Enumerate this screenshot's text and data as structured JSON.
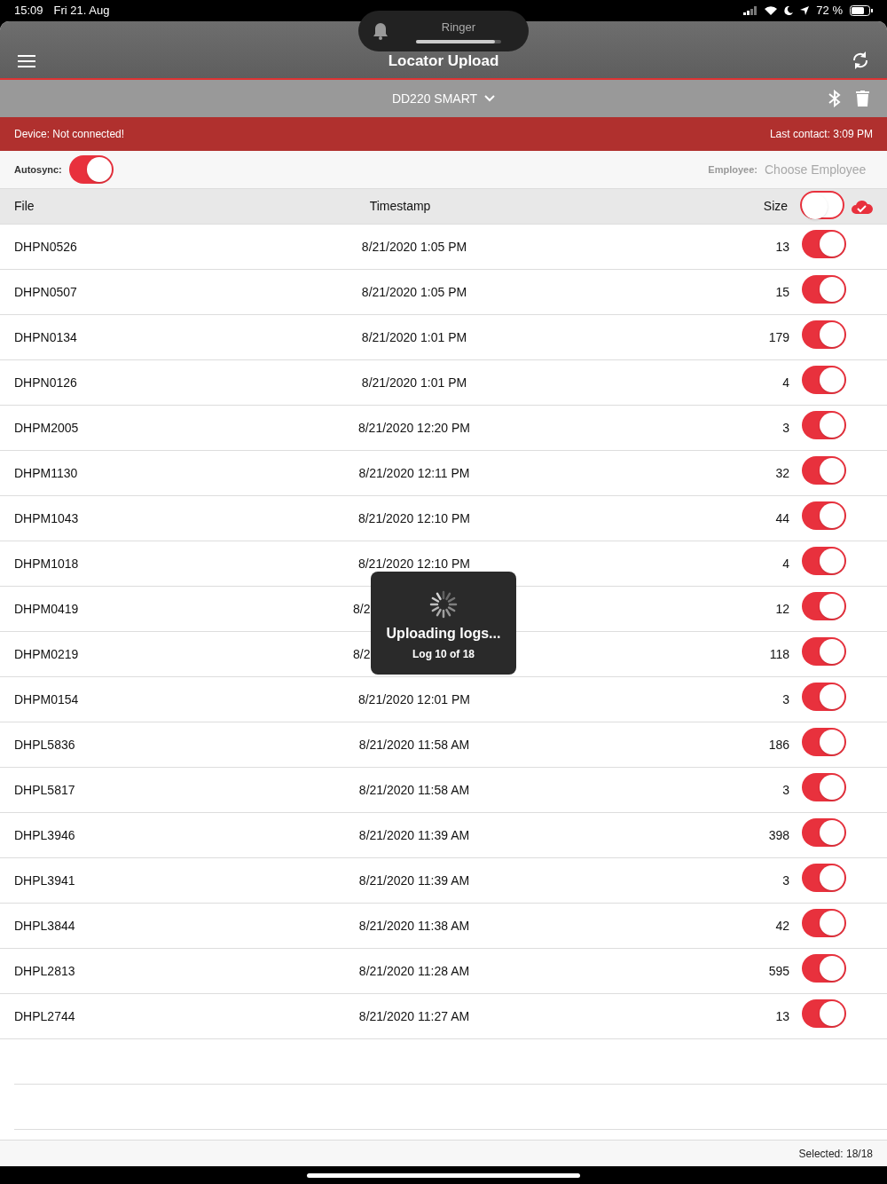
{
  "status_bar": {
    "time": "15:09",
    "date": "Fri 21. Aug",
    "battery": "72 %"
  },
  "ringer": {
    "label": "Ringer",
    "level": 0.93
  },
  "header": {
    "title": "Locator Upload"
  },
  "device": {
    "name": "DD220 SMART"
  },
  "banner": {
    "status": "Device: Not connected!",
    "last_contact": "Last contact: 3:09 PM"
  },
  "options": {
    "autosync_label": "Autosync:",
    "autosync_on": true,
    "employee_label": "Employee:",
    "employee_placeholder": "Choose Employee"
  },
  "table": {
    "columns": [
      "File",
      "Timestamp",
      "Size"
    ],
    "select_all_on": false,
    "rows": [
      {
        "file": "DHPN0526",
        "timestamp": "8/21/2020 1:05 PM",
        "size": "13",
        "on": true
      },
      {
        "file": "DHPN0507",
        "timestamp": "8/21/2020 1:05 PM",
        "size": "15",
        "on": true
      },
      {
        "file": "DHPN0134",
        "timestamp": "8/21/2020 1:01 PM",
        "size": "179",
        "on": true
      },
      {
        "file": "DHPN0126",
        "timestamp": "8/21/2020 1:01 PM",
        "size": "4",
        "on": true
      },
      {
        "file": "DHPM2005",
        "timestamp": "8/21/2020 12:20 PM",
        "size": "3",
        "on": true
      },
      {
        "file": "DHPM1130",
        "timestamp": "8/21/2020 12:11 PM",
        "size": "32",
        "on": true
      },
      {
        "file": "DHPM1043",
        "timestamp": "8/21/2020 12:10 PM",
        "size": "44",
        "on": true
      },
      {
        "file": "DHPM1018",
        "timestamp": "8/21/2020 12:10 PM",
        "size": "4",
        "on": true
      },
      {
        "file": "DHPM0419",
        "timestamp": "8/2",
        "covered": true,
        "size": "12",
        "on": true
      },
      {
        "file": "DHPM0219",
        "timestamp": "8/2",
        "covered": true,
        "size": "118",
        "on": true
      },
      {
        "file": "DHPM0154",
        "timestamp": "8/21/2020 12:01 PM",
        "size": "3",
        "on": true
      },
      {
        "file": "DHPL5836",
        "timestamp": "8/21/2020 11:58 AM",
        "size": "186",
        "on": true
      },
      {
        "file": "DHPL5817",
        "timestamp": "8/21/2020 11:58 AM",
        "size": "3",
        "on": true
      },
      {
        "file": "DHPL3946",
        "timestamp": "8/21/2020 11:39 AM",
        "size": "398",
        "on": true
      },
      {
        "file": "DHPL3941",
        "timestamp": "8/21/2020 11:39 AM",
        "size": "3",
        "on": true
      },
      {
        "file": "DHPL3844",
        "timestamp": "8/21/2020 11:38 AM",
        "size": "42",
        "on": true
      },
      {
        "file": "DHPL2813",
        "timestamp": "8/21/2020 11:28 AM",
        "size": "595",
        "on": true
      },
      {
        "file": "DHPL2744",
        "timestamp": "8/21/2020 11:27 AM",
        "size": "13",
        "on": true
      }
    ]
  },
  "progress": {
    "title": "Uploading logs...",
    "detail": "Log 10 of 18"
  },
  "footer": {
    "selected": "Selected: 18/18"
  }
}
